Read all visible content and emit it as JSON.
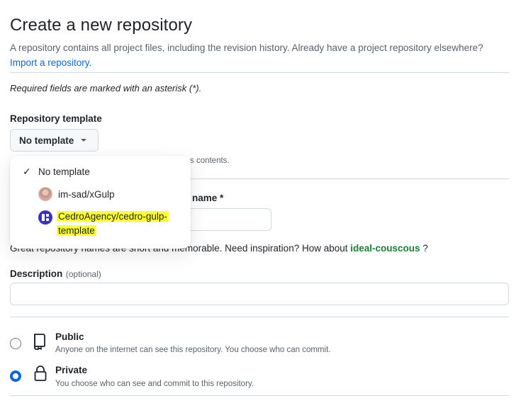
{
  "header": {
    "title": "Create a new repository",
    "subtitle": "A repository contains all project files, including the revision history. Already have a project repository elsewhere?",
    "import_link": "Import a repository."
  },
  "required_note": "Required fields are marked with an asterisk (*).",
  "template": {
    "label": "Repository template",
    "button_label": "No template",
    "hint_fragment": "s contents.",
    "menu": [
      {
        "label": "No template",
        "checked": true
      },
      {
        "label": "im-sad/xGulp",
        "icon": "user-avatar"
      },
      {
        "label_line1": "CedroAgency/cedro-gulp-",
        "label_line2": "template",
        "icon": "org-avatar"
      }
    ]
  },
  "repo_name": {
    "label_fragment": "name *",
    "value": ""
  },
  "name_hint": {
    "text": "Great repository names are short and memorable. Need inspiration? How about ",
    "suggestion": "ideal-couscous",
    "suffix": " ?"
  },
  "description": {
    "label": "Description",
    "optional": "(optional)",
    "value": ""
  },
  "visibility": {
    "public": {
      "title": "Public",
      "desc": "Anyone on the internet can see this repository. You choose who can commit.",
      "selected": false
    },
    "private": {
      "title": "Private",
      "desc": "You choose who can see and commit to this repository.",
      "selected": true
    }
  },
  "colors": {
    "accent": "#0969da",
    "highlight": "#ffff33",
    "suggestion": "#1a7f37"
  }
}
